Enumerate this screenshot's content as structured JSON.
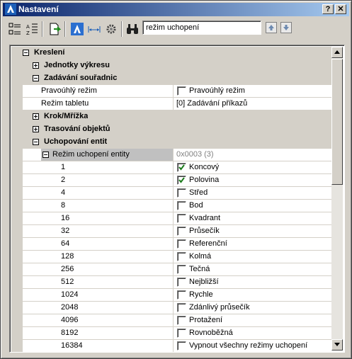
{
  "window": {
    "title": "Nastavení",
    "help_btn": "?",
    "close_btn": "✕"
  },
  "toolbar": {
    "search_value": "režim uchopení"
  },
  "tree": {
    "root_label": "Kreslení",
    "units_label": "Jednotky výkresu",
    "coords_label": "Zadávání souřadnic",
    "ortho_label": "Pravoúhlý režim",
    "ortho_value": "Pravoúhlý režim",
    "tablet_label": "Režim tabletu",
    "tablet_value": "[0] Zadávání příkazů",
    "step_label": "Krok/Mřížka",
    "tracking_label": "Trasování objektů",
    "osnap_label": "Uchopování entit",
    "osnap_mode_label": "Režim uchopení entity",
    "osnap_mode_value": "0x0003 (3)"
  },
  "snap_rows": [
    {
      "code": "1",
      "name": "Koncový",
      "checked": true
    },
    {
      "code": "2",
      "name": "Polovina",
      "checked": true
    },
    {
      "code": "4",
      "name": "Střed",
      "checked": false
    },
    {
      "code": "8",
      "name": "Bod",
      "checked": false
    },
    {
      "code": "16",
      "name": "Kvadrant",
      "checked": false
    },
    {
      "code": "32",
      "name": "Průsečík",
      "checked": false
    },
    {
      "code": "64",
      "name": "Referenční",
      "checked": false
    },
    {
      "code": "128",
      "name": "Kolmá",
      "checked": false
    },
    {
      "code": "256",
      "name": "Tečná",
      "checked": false
    },
    {
      "code": "512",
      "name": "Nejbližší",
      "checked": false
    },
    {
      "code": "1024",
      "name": "Rychle",
      "checked": false
    },
    {
      "code": "2048",
      "name": "Zdánlivý průsečík",
      "checked": false
    },
    {
      "code": "4096",
      "name": "Protažení",
      "checked": false
    },
    {
      "code": "8192",
      "name": "Rovnoběžná",
      "checked": false
    },
    {
      "code": "16384",
      "name": "Vypnout všechny režimy uchopení",
      "checked": false
    }
  ],
  "colors": {
    "title_start": "#0a246a",
    "title_end": "#a6caf0",
    "check": "#1a7a1a"
  }
}
